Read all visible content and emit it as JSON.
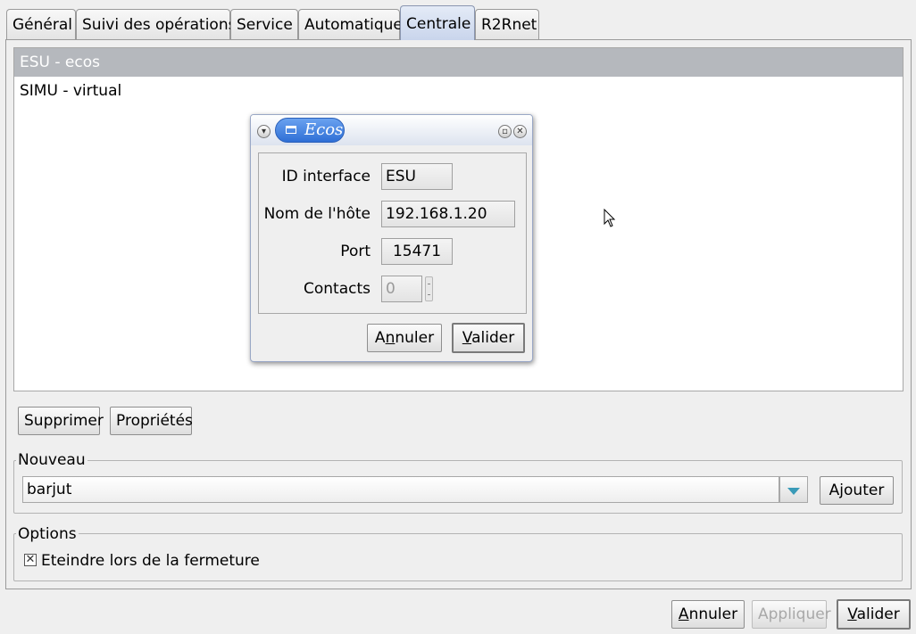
{
  "tabs": [
    {
      "label": "Général"
    },
    {
      "label": "Suivi des opérations"
    },
    {
      "label": "Service"
    },
    {
      "label": "Automatique"
    },
    {
      "label": "Centrale",
      "active": true
    },
    {
      "label": "R2Rnet"
    }
  ],
  "centrales": [
    {
      "label": "ESU - ecos",
      "selected": true
    },
    {
      "label": "SIMU - virtual"
    }
  ],
  "list_buttons": {
    "delete": "Supprimer",
    "properties": "Propriétés"
  },
  "nouveau": {
    "title": "Nouveau",
    "value": "barjut",
    "add": "Ajouter"
  },
  "options": {
    "title": "Options",
    "shutdown_label": "Eteindre lors de la fermeture",
    "shutdown_checked": true,
    "check_mark": "✕"
  },
  "footer": {
    "cancel_accel": "A",
    "cancel_rest": "nnuler",
    "apply": "Appliquer",
    "ok_accel": "V",
    "ok_rest": "alider"
  },
  "dialog": {
    "title": "Ecos",
    "id_label": "ID interface",
    "id_value": "ESU",
    "host_label": "Nom de l'hôte",
    "host_value": "192.168.1.20",
    "port_label": "Port",
    "port_value": "15471",
    "contacts_label": "Contacts",
    "contacts_value": "0",
    "cancel_pre": "A",
    "cancel_accel": "n",
    "cancel_rest": "nuler",
    "ok_accel": "V",
    "ok_rest": "alider"
  },
  "icons": {
    "menu": "chevron-down-icon",
    "maximize": "maximize-icon",
    "close": "close-icon",
    "cursor": "mouse-pointer-icon"
  },
  "colors": {
    "selection": "#b5b8bd",
    "title_pill": "#2f6fd6",
    "active_tab": "#c9d5ec",
    "combo_arrow": "#3a9bb8"
  }
}
